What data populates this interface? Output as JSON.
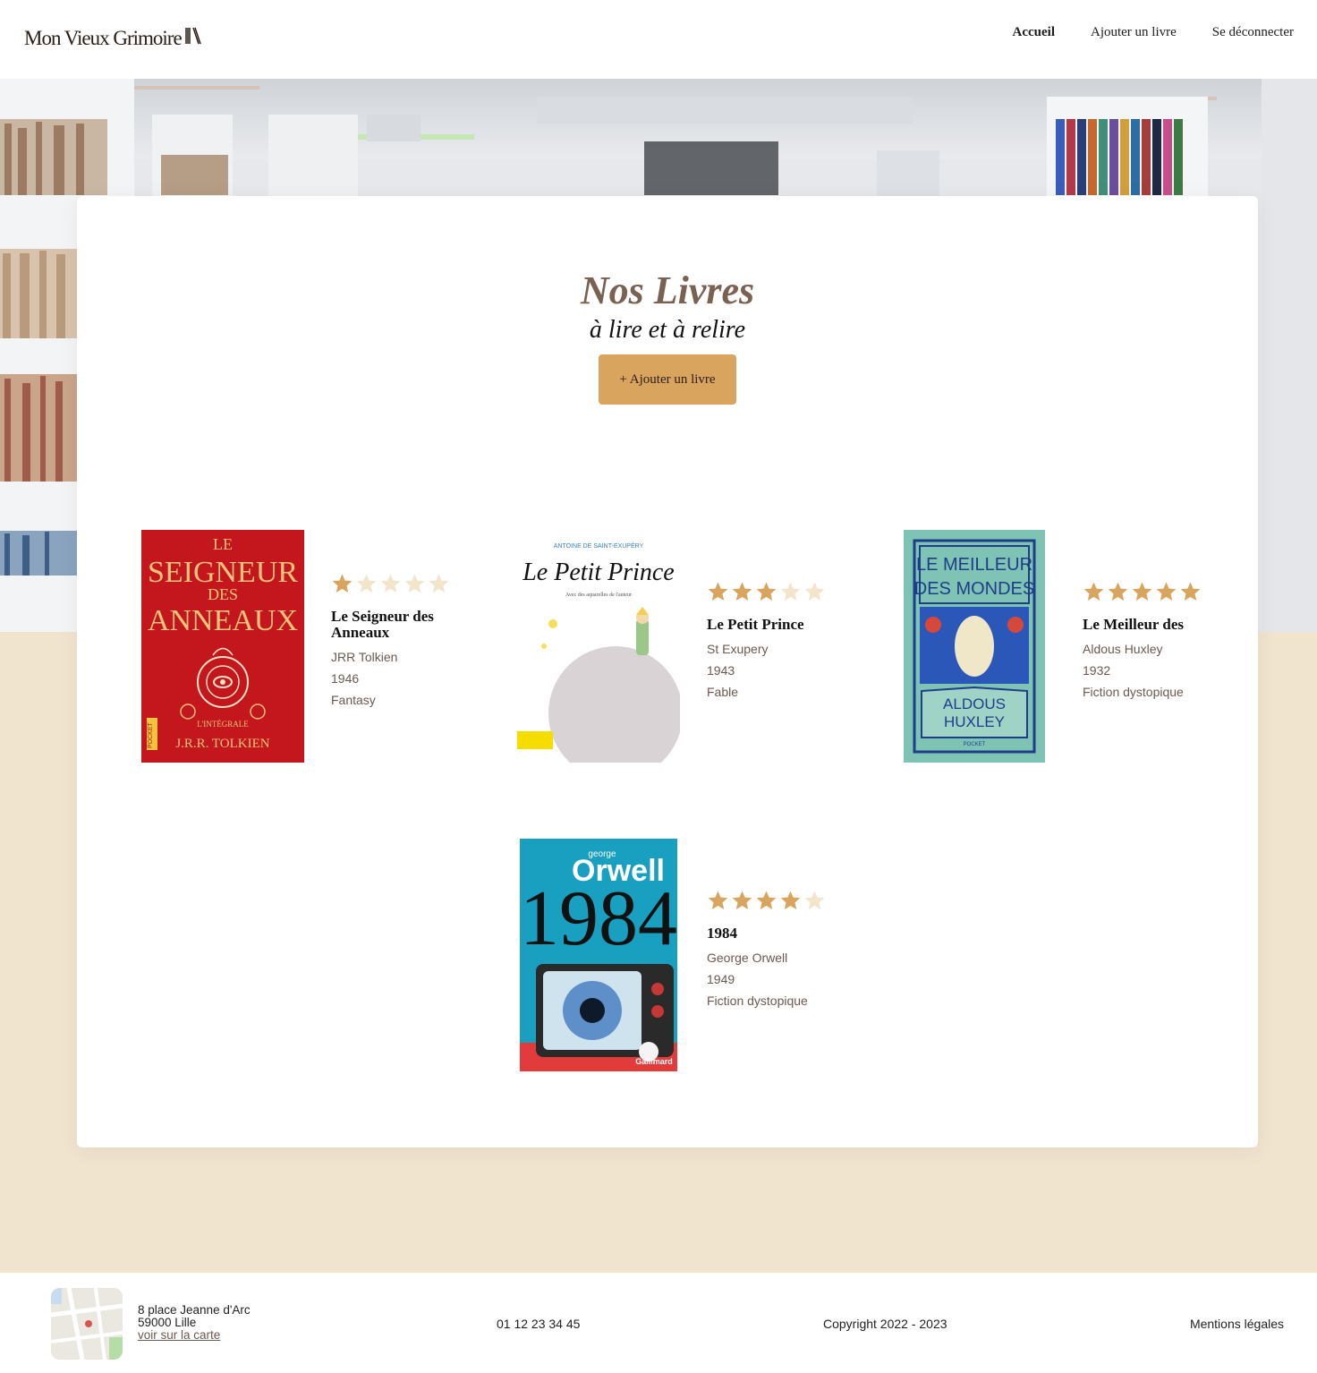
{
  "header": {
    "logo": "Mon Vieux Grimoire",
    "nav": [
      {
        "label": "Accueil",
        "active": true
      },
      {
        "label": "Ajouter un livre",
        "active": false
      },
      {
        "label": "Se déconnecter",
        "active": false
      }
    ]
  },
  "main": {
    "title": "Nos Livres",
    "subtitle": "à lire et à relire",
    "add_button": "+ Ajouter un livre"
  },
  "books": [
    {
      "title": "Le Seigneur des Anneaux",
      "author": "JRR Tolkien",
      "year": "1946",
      "genre": "Fantasy",
      "rating": 1,
      "cover": {
        "top": "LE",
        "line1": "SEIGNEUR",
        "line2": "DES",
        "line3": "ANNEAUX",
        "edition": "L'INTÉGRALE",
        "author": "J.R.R. TOLKIEN",
        "publisher": "POCKET"
      }
    },
    {
      "title": "Le Petit Prince",
      "author": "St Exupery",
      "year": "1943",
      "genre": "Fable",
      "rating": 3,
      "cover": {
        "author": "ANTOINE DE SAINT-EXUPÉRY",
        "title": "Le Petit Prince",
        "note": "Avec des aquarelles de l'auteur"
      }
    },
    {
      "title": "Le Meilleur des",
      "author": "Aldous Huxley",
      "year": "1932",
      "genre": "Fiction dystopique",
      "rating": 5,
      "cover": {
        "line1": "LE MEILLEUR",
        "line2": "DES MONDES",
        "author1": "ALDOUS",
        "author2": "HUXLEY",
        "publisher": "POCKET"
      }
    },
    {
      "title": "1984",
      "author": "George Orwell",
      "year": "1949",
      "genre": "Fiction dystopique",
      "rating": 4,
      "cover": {
        "first": "george",
        "last": "Orwell",
        "title": "1984",
        "publisher": "Gallimard"
      }
    }
  ],
  "footer": {
    "address_line1": "8 place Jeanne d'Arc",
    "address_line2": "59000 Lille",
    "map_link": "voir sur la carte",
    "phone": "01 12 23 34 45",
    "copyright": "Copyright 2022 - 2023",
    "legal": "Mentions légales"
  },
  "colors": {
    "accent": "#d9a45e",
    "star_empty": "#f3e4cc",
    "beige_bg": "#f1e4cf",
    "title_brown": "#7a6253"
  }
}
